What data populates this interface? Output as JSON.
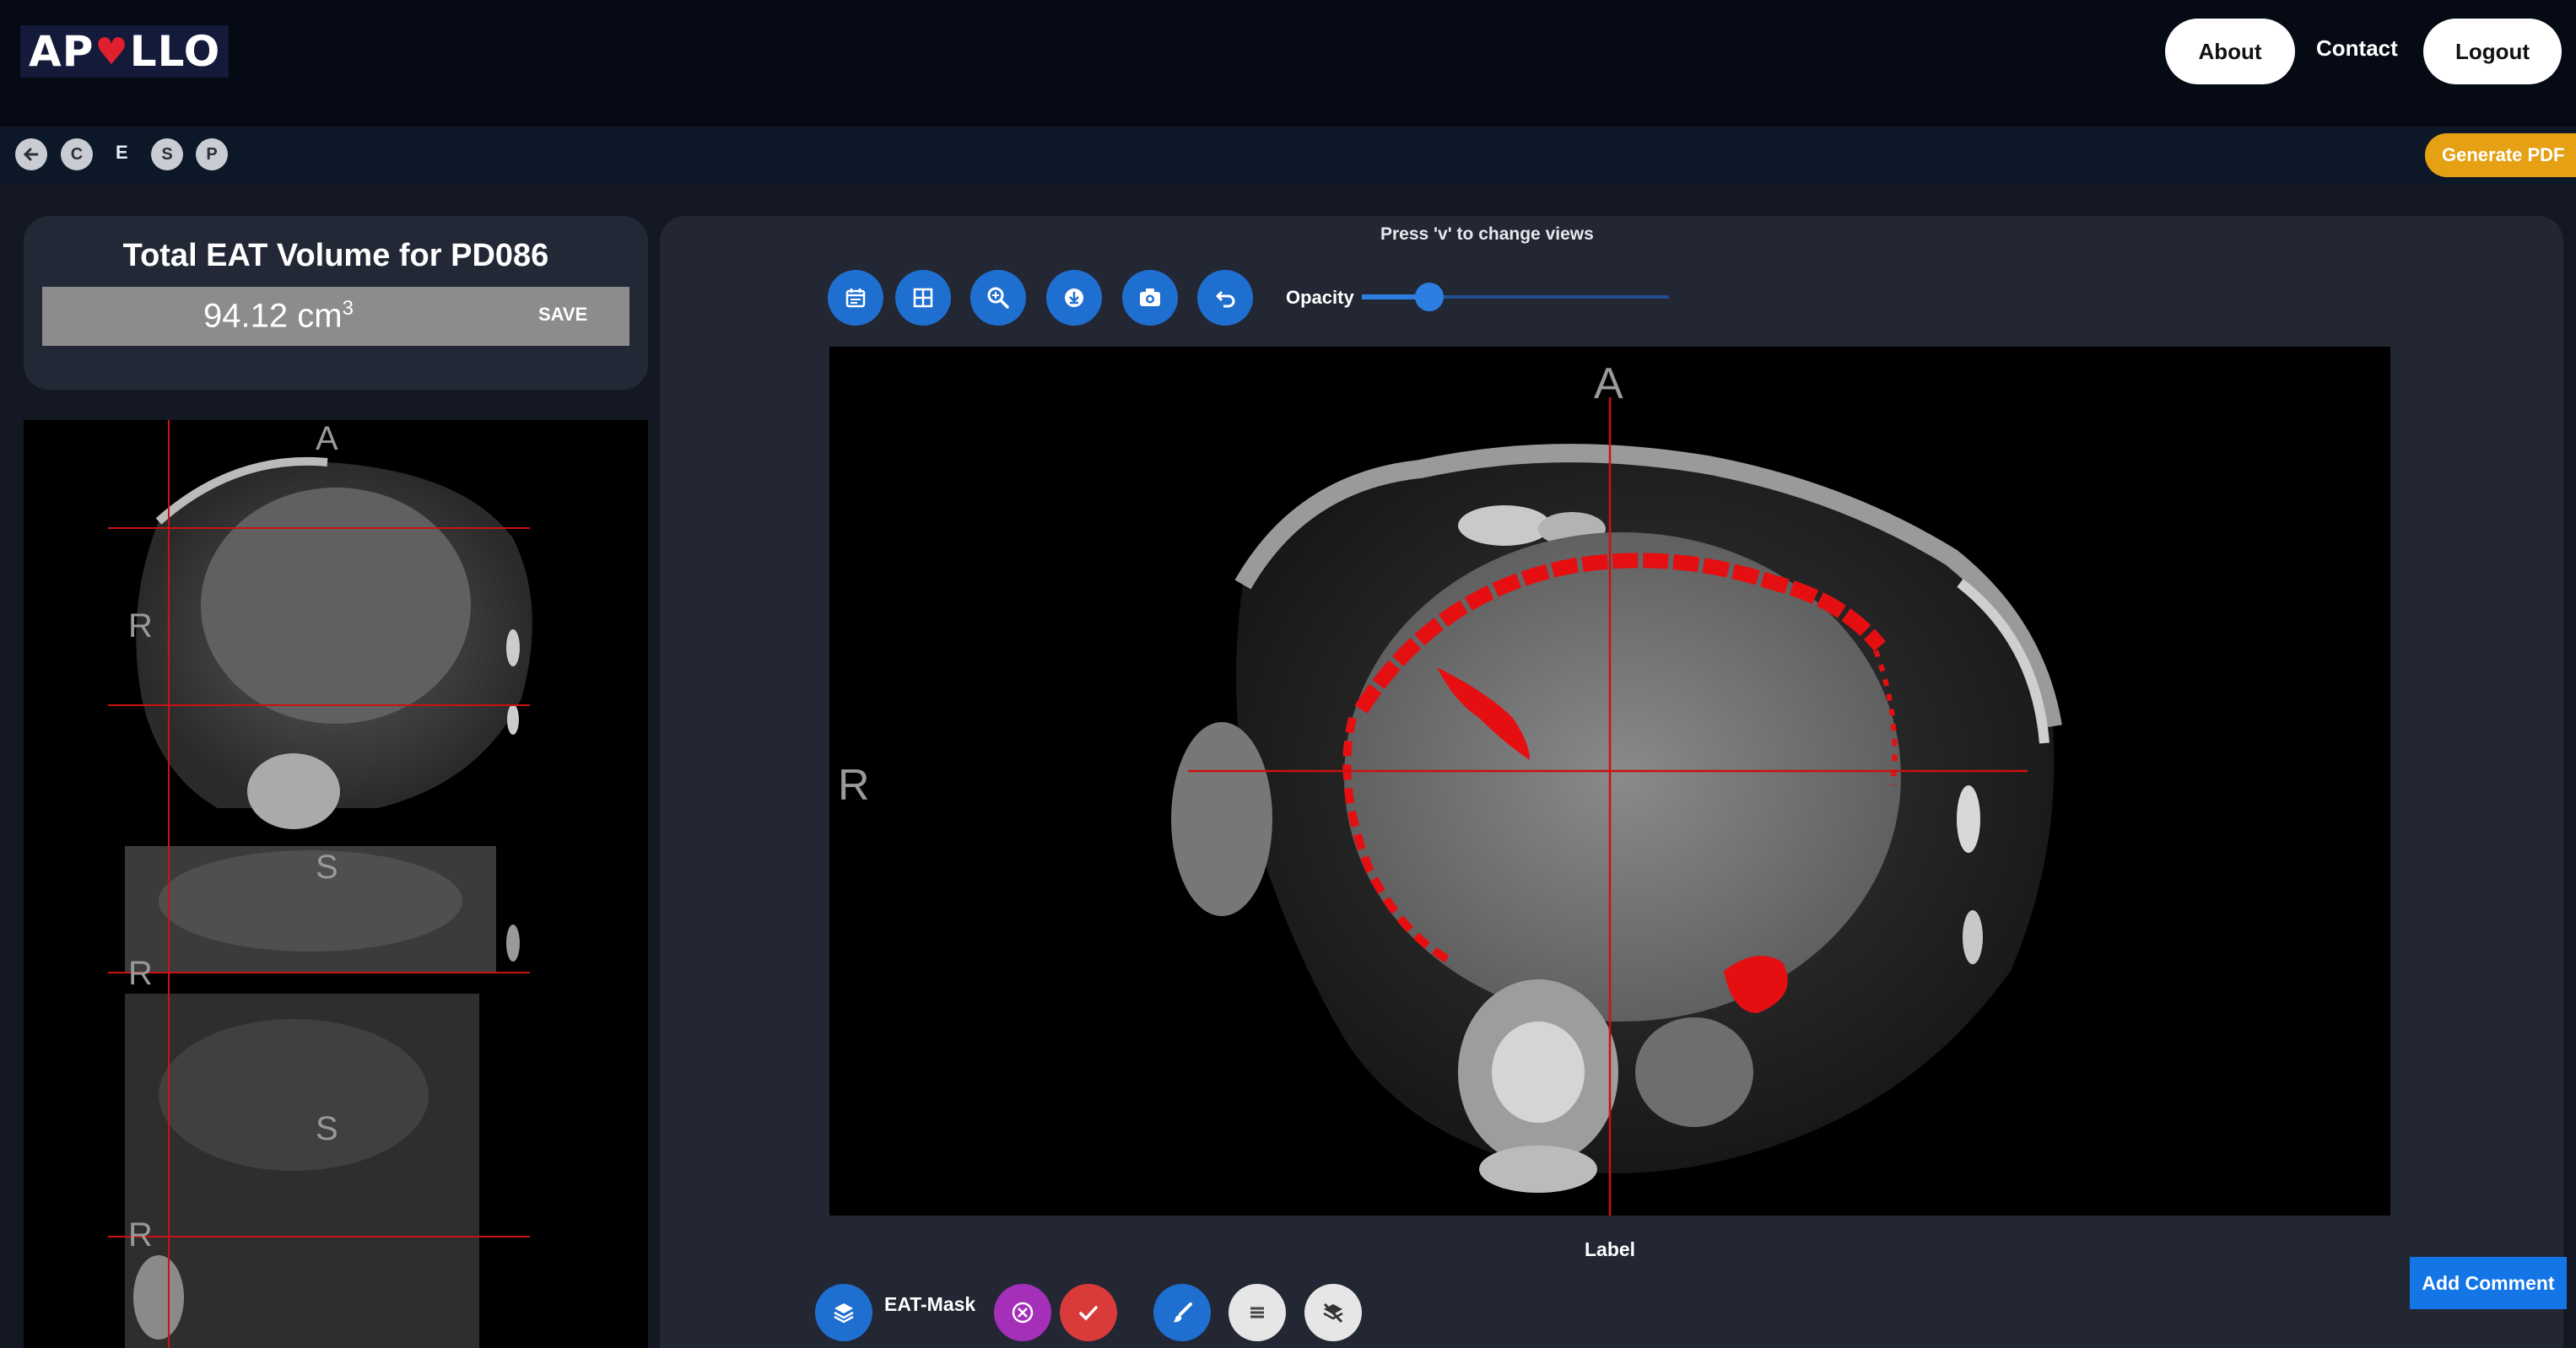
{
  "header": {
    "logo_left": "AP",
    "logo_right": "LLO",
    "about_label": "About",
    "contact_label": "Contact",
    "logout_label": "Logout"
  },
  "navbar": {
    "circles": [
      "C",
      "S",
      "P"
    ],
    "letter_e": "E",
    "generate_pdf_label": "Generate PDF"
  },
  "volume_card": {
    "title": "Total EAT Volume for PD086",
    "value": "94.12 cm",
    "unit_exponent": "3",
    "save_label": "SAVE"
  },
  "side_panel": {
    "labels": [
      "A",
      "R",
      "S",
      "R",
      "S",
      "R"
    ]
  },
  "viewer": {
    "hint": "Press 'v' to change views",
    "opacity_label": "Opacity",
    "opacity_value": 0.22,
    "orientation_top": "A",
    "orientation_left": "R",
    "label_text": "Label",
    "mask_label": "EAT-Mask",
    "add_comment_label": "Add Comment",
    "toolbar_icons": [
      "calendar-icon",
      "grid-icon",
      "zoom-icon",
      "download-icon",
      "camera-icon",
      "undo-icon"
    ],
    "bottom_icons": [
      "layers-icon",
      "clear-icon",
      "check-icon",
      "brush-icon",
      "notes-icon",
      "hide-layers-icon"
    ]
  },
  "colors": {
    "accent_blue": "#1f6fd0",
    "mask_red": "#e50f12",
    "generate_pdf": "#e5a113",
    "purple": "#a42fb8",
    "red_button": "#d93a3a"
  }
}
